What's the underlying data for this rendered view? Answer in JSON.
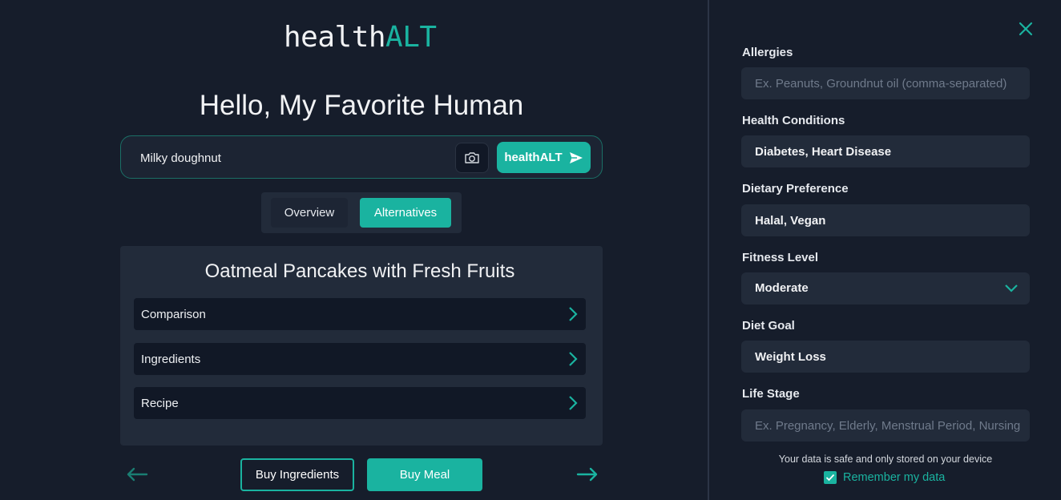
{
  "brand": {
    "part1": "health",
    "part2": "ALT"
  },
  "greeting": "Hello, My Favorite Human",
  "search": {
    "value": "Milky doughnut",
    "submit_label": "healthALT",
    "camera_icon": "camera-icon",
    "send_icon": "send-icon"
  },
  "tabs": [
    {
      "label": "Overview",
      "active": false
    },
    {
      "label": "Alternatives",
      "active": true
    }
  ],
  "result": {
    "title": "Oatmeal Pancakes with Fresh Fruits",
    "sections": [
      {
        "label": "Comparison"
      },
      {
        "label": "Ingredients"
      },
      {
        "label": "Recipe"
      }
    ]
  },
  "actions": {
    "buy_ingredients": "Buy Ingredients",
    "buy_meal": "Buy Meal"
  },
  "profile": {
    "allergies": {
      "label": "Allergies",
      "value": "",
      "placeholder": "Ex. Peanuts, Groundnut oil (comma-separated)"
    },
    "health_conditions": {
      "label": "Health Conditions",
      "value": "Diabetes, Heart Disease"
    },
    "dietary_preference": {
      "label": "Dietary Preference",
      "value": "Halal, Vegan"
    },
    "fitness_level": {
      "label": "Fitness Level",
      "value": "Moderate"
    },
    "diet_goal": {
      "label": "Diet Goal",
      "value": "Weight Loss"
    },
    "life_stage": {
      "label": "Life Stage",
      "value": "",
      "placeholder": "Ex. Pregnancy, Elderly, Menstrual Period, Nursing"
    },
    "privacy_note": "Your data is safe and only stored on your device",
    "remember_label": "Remember my data",
    "remember_checked": true
  },
  "colors": {
    "accent": "#1ab3a0",
    "background": "#161d2b",
    "surface": "#222b3a",
    "dark_surface": "#111826"
  }
}
